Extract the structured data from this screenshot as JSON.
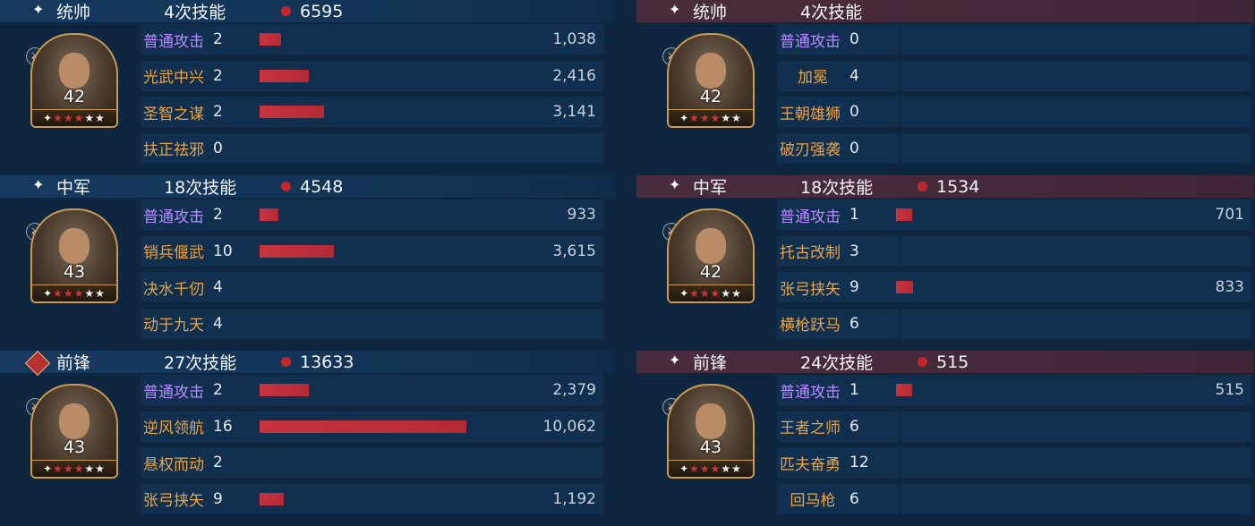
{
  "left": [
    {
      "role": "统帅",
      "casts": "4次技能",
      "damage": "6595",
      "level": "42",
      "skills": [
        {
          "name": "普通攻击",
          "count": "2",
          "value": "1,038",
          "bar": 1038,
          "normal": true
        },
        {
          "name": "光武中兴",
          "count": "2",
          "value": "2,416",
          "bar": 2416
        },
        {
          "name": "圣智之谋",
          "count": "2",
          "value": "3,141",
          "bar": 3141
        },
        {
          "name": "扶正祛邪",
          "count": "0",
          "value": "",
          "bar": 0
        }
      ]
    },
    {
      "role": "中军",
      "casts": "18次技能",
      "damage": "4548",
      "level": "43",
      "skills": [
        {
          "name": "普通攻击",
          "count": "2",
          "value": "933",
          "bar": 933,
          "normal": true
        },
        {
          "name": "销兵偃武",
          "count": "10",
          "value": "3,615",
          "bar": 3615
        },
        {
          "name": "决水千仞",
          "count": "4",
          "value": "",
          "bar": 0
        },
        {
          "name": "动于九天",
          "count": "4",
          "value": "",
          "bar": 0
        }
      ]
    },
    {
      "role": "前锋",
      "casts": "27次技能",
      "damage": "13633",
      "level": "43",
      "skills": [
        {
          "name": "普通攻击",
          "count": "2",
          "value": "2,379",
          "bar": 2379,
          "normal": true
        },
        {
          "name": "逆风领航",
          "count": "16",
          "value": "10,062",
          "bar": 10062
        },
        {
          "name": "悬权而动",
          "count": "2",
          "value": "",
          "bar": 0
        },
        {
          "name": "张弓挟矢",
          "count": "9",
          "value": "1,192",
          "bar": 1192
        }
      ]
    }
  ],
  "right": [
    {
      "role": "统帅",
      "casts": "4次技能",
      "damage": "",
      "level": "42",
      "skills": [
        {
          "name": "普通攻击",
          "count": "0",
          "value": "",
          "bar": 0,
          "normal": true
        },
        {
          "name": "加冕",
          "count": "4",
          "value": "",
          "bar": 0
        },
        {
          "name": "王朝雄狮",
          "count": "0",
          "value": "",
          "bar": 0
        },
        {
          "name": "破刃强袭",
          "count": "0",
          "value": "",
          "bar": 0
        }
      ]
    },
    {
      "role": "中军",
      "casts": "18次技能",
      "damage": "1534",
      "level": "42",
      "skills": [
        {
          "name": "普通攻击",
          "count": "1",
          "value": "701",
          "bar": 701,
          "normal": true
        },
        {
          "name": "托古改制",
          "count": "3",
          "value": "",
          "bar": 0
        },
        {
          "name": "张弓挟矢",
          "count": "9",
          "value": "833",
          "bar": 833
        },
        {
          "name": "横枪跃马",
          "count": "6",
          "value": "",
          "bar": 0
        }
      ]
    },
    {
      "role": "前锋",
      "casts": "24次技能",
      "damage": "515",
      "level": "43",
      "skills": [
        {
          "name": "普通攻击",
          "count": "1",
          "value": "515",
          "bar": 515,
          "normal": true
        },
        {
          "name": "王者之师",
          "count": "6",
          "value": "",
          "bar": 0
        },
        {
          "name": "匹夫奋勇",
          "count": "12",
          "value": "",
          "bar": 0
        },
        {
          "name": "回马枪",
          "count": "6",
          "value": "",
          "bar": 0
        }
      ]
    }
  ],
  "bar_max": 10062,
  "colors": {
    "bar": "#c7343f",
    "skill_name": "#e9a447",
    "normal_attack": "#b78cff",
    "dmg_dot": "#c2262c"
  }
}
